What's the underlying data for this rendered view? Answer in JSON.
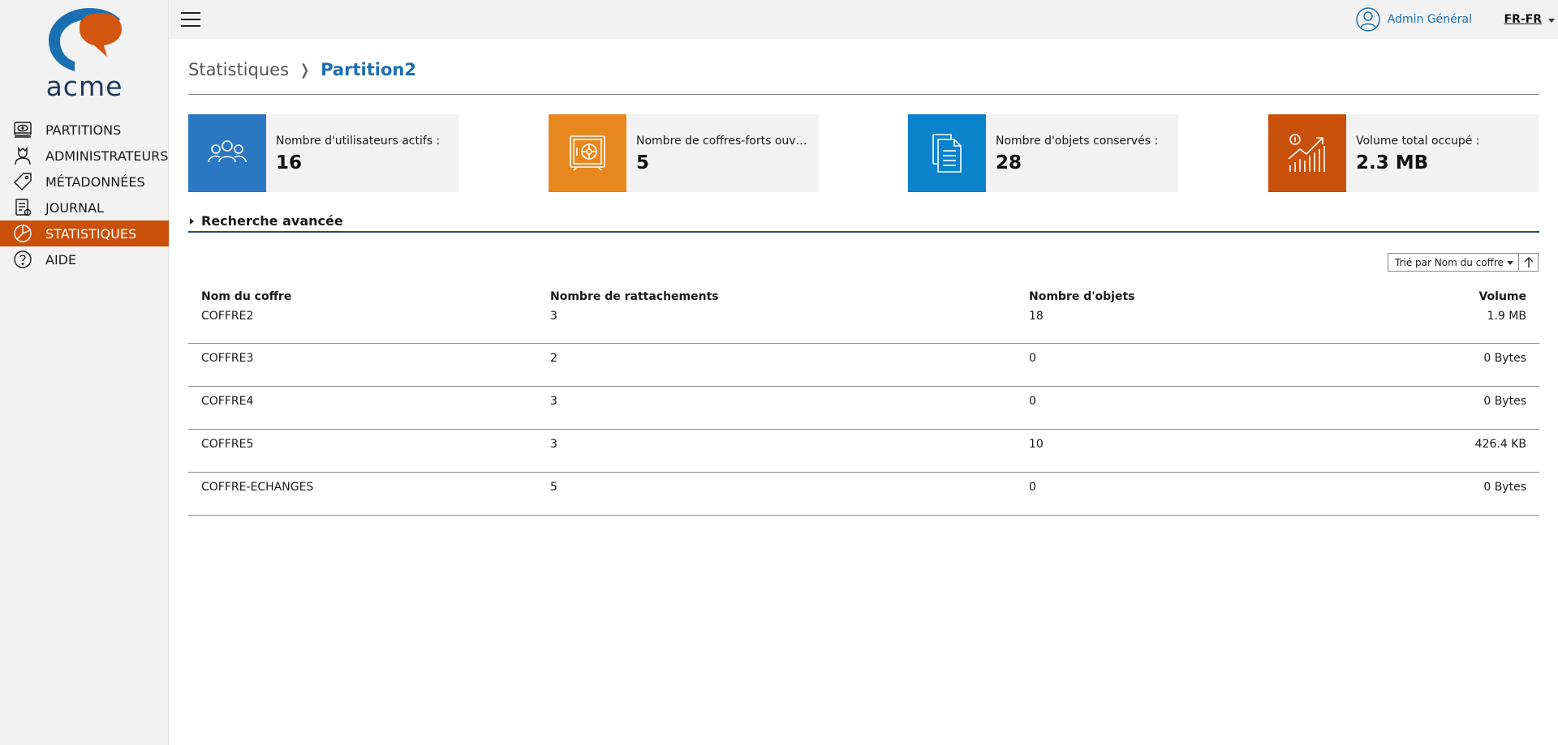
{
  "brand": {
    "logo_text": "acme",
    "colors": {
      "accent": "#c9500a",
      "blue": "#1a6fb0",
      "navy": "#1d3a5c"
    }
  },
  "sidebar": {
    "items": [
      {
        "label": "PARTITIONS",
        "icon": "disk-drive-icon",
        "active": false
      },
      {
        "label": "ADMINISTRATEURS",
        "icon": "user-admin-icon",
        "active": false
      },
      {
        "label": "MÉTADONNÉES",
        "icon": "tag-icon",
        "active": false
      },
      {
        "label": "JOURNAL",
        "icon": "log-document-icon",
        "active": false
      },
      {
        "label": "STATISTIQUES",
        "icon": "pie-chart-icon",
        "active": true
      },
      {
        "label": "AIDE",
        "icon": "help-circle-icon",
        "active": false
      }
    ]
  },
  "topbar": {
    "user_name": "Admin Général",
    "language": "FR-FR"
  },
  "breadcrumb": {
    "root": "Statistiques",
    "separator": "❭",
    "current": "Partition2"
  },
  "cards": [
    {
      "label": "Nombre d'utilisateurs actifs :",
      "value": "16",
      "color": "#2a78c2",
      "icon": "users-group-icon"
    },
    {
      "label": "Nombre de coffres-forts ouverts :",
      "value": "5",
      "color": "#e8871e",
      "icon": "safe-icon"
    },
    {
      "label": "Nombre d'objets conservés :",
      "value": "28",
      "color": "#0b82cc",
      "icon": "documents-icon"
    },
    {
      "label": "Volume total occupé :",
      "value": "2.3 MB",
      "color": "#c9500a",
      "icon": "growth-chart-icon"
    }
  ],
  "advanced_search": {
    "label": "Recherche avancée"
  },
  "sort": {
    "label": "Trié par Nom du coffre"
  },
  "table": {
    "headers": [
      "Nom du coffre",
      "Nombre de rattachements",
      "Nombre d'objets",
      "Volume"
    ],
    "rows": [
      [
        "COFFRE2",
        "3",
        "18",
        "1.9 MB"
      ],
      [
        "COFFRE3",
        "2",
        "0",
        "0 Bytes"
      ],
      [
        "COFFRE4",
        "3",
        "0",
        "0 Bytes"
      ],
      [
        "COFFRE5",
        "3",
        "10",
        "426.4 KB"
      ],
      [
        "COFFRE-ECHANGES",
        "5",
        "0",
        "0 Bytes"
      ]
    ]
  }
}
